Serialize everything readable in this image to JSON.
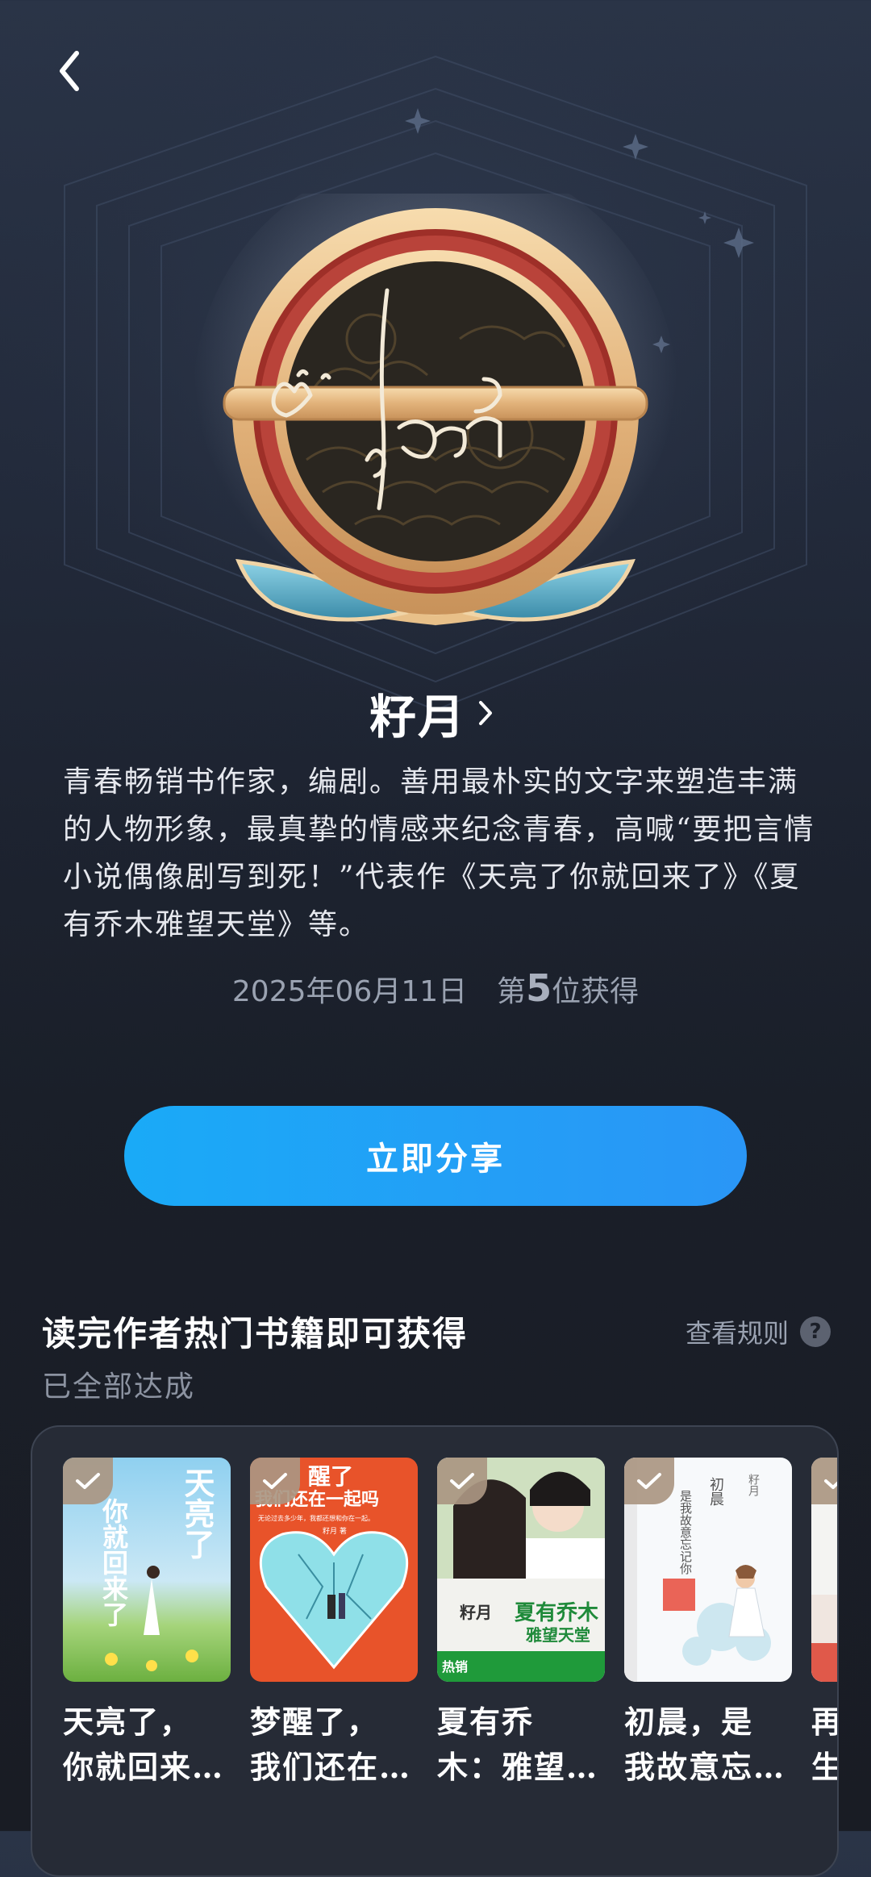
{
  "nav": {
    "back_icon": "chevron-left-icon"
  },
  "badge": {
    "icon": "author-signature-medal-icon"
  },
  "author": {
    "name": "籽月",
    "chevron_icon": "chevron-right-icon",
    "bio": "青春畅销书作家，编剧。善用最朴实的文字来塑造丰满的人物形象，最真挚的情感来纪念青春，高喊“要把言情小说偶像剧写到死！”代表作《天亮了你就回来了》《夏有乔木雅望天堂》等。"
  },
  "award": {
    "date": "2025年06月11日",
    "rank_prefix": "第",
    "rank": "5",
    "rank_suffix": "位获得"
  },
  "share_button": {
    "label": "立即分享",
    "color": "#1aaaf7"
  },
  "books_section": {
    "title": "读完作者热门书籍即可获得",
    "rules_label": "查看规则",
    "help_icon": "?",
    "status": "已全部达成",
    "books": [
      {
        "title": "天亮了，\n你就回来…",
        "cover_text": "天亮了",
        "cover_text2": "你就回来了",
        "completed": true
      },
      {
        "title": "梦醒了，\n我们还在…",
        "cover_text": "醒了",
        "cover_text2": "我们还在一起吗",
        "cover_text3": "无论过去多少年，我都还想和你在一起。",
        "cover_text4": "籽月 著",
        "completed": true
      },
      {
        "title": "夏有乔\n木：雅望…",
        "cover_text": "夏有乔木",
        "cover_text2": "雅望天堂",
        "cover_text3": "籽月",
        "cover_text4": "热销",
        "completed": true
      },
      {
        "title": "初晨，是\n我故意忘…",
        "cover_text": "初晨",
        "cover_text2": "是我故意忘记你",
        "cover_text3": "籽月",
        "completed": true
      },
      {
        "title": "再\n生",
        "completed": true
      }
    ]
  }
}
